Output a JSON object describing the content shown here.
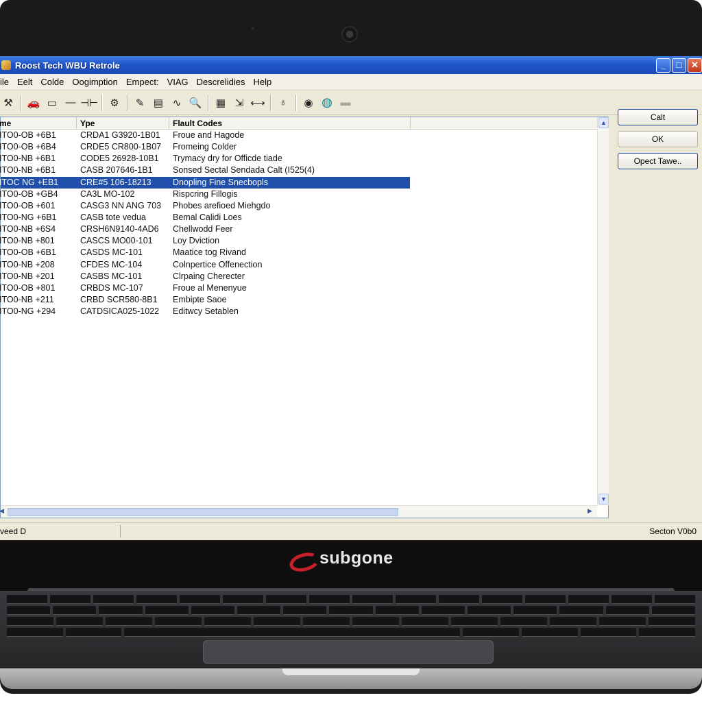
{
  "window": {
    "title": "Roost Tech WBU Retrole",
    "min_glyph": "_",
    "max_glyph": "□",
    "close_glyph": "✕"
  },
  "menu": [
    "ile",
    "Eelt",
    "Colde",
    "Oogimption",
    "Empect:",
    "VIAG",
    "Descrelidies",
    "Help"
  ],
  "toolbar": {
    "icons": [
      "wrench-icon",
      "car-icon",
      "monitor-icon",
      "minus-icon",
      "split-icon",
      "gauge-icon",
      "edit-icon",
      "clipboard-icon",
      "chart-icon",
      "search-icon",
      "list-icon",
      "export-icon",
      "arrows-icon",
      "bulb-icon",
      "globe-icon",
      "help-circle-icon",
      "printer-icon"
    ],
    "glyphs": [
      "⚒",
      "🚗",
      "▭",
      "—",
      "⊣⊢",
      "⚙",
      "✎",
      "▤",
      "∿",
      "🔍",
      "▦",
      "⇲",
      "⟷",
      "♁",
      "◉",
      "◍",
      "▬"
    ]
  },
  "list": {
    "columns": [
      "me",
      "Ype",
      "Flault Codes"
    ],
    "rows": [
      {
        "name": "ITO0-OB +6B1",
        "type": "CRDA1 G3920-1B01",
        "code": "Froue and Hagode"
      },
      {
        "name": "ITO0-OB +6B4",
        "type": "CRDE5 CR800-1B07",
        "code": "Fromeing Colder"
      },
      {
        "name": "ITO0-NB +6B1",
        "type": "CODE5 26928-10B1",
        "code": "Trymacy dry for Officde tiade"
      },
      {
        "name": "ITO0-NB +6B1",
        "type": "CASB 207646-1B1",
        "code": "Sonsed Sectal Sendada Calt (I525(4)"
      },
      {
        "name": "ITOC NG +EB1",
        "type": "CRE#5 106-18213",
        "code": "Dnopling Fine Snecbopls"
      },
      {
        "name": "ITO0-OB +GB4",
        "type": "CA3L MO-102",
        "code": "Rispcring Fillogis"
      },
      {
        "name": "ITO0-OB +601",
        "type": "CASG3 NN ANG 703",
        "code": "Phobes arefioed Miehgdo"
      },
      {
        "name": "ITO0-NG +6B1",
        "type": "CASB tote vedua",
        "code": "Bemal Calidi Loes"
      },
      {
        "name": "ITO0-NB +6S4",
        "type": "CRSH6N9140-4AD6",
        "code": "Chellwodd Feer"
      },
      {
        "name": "ITO0-NB +801",
        "type": "CASCS MO00-101",
        "code": "Loy Dviction"
      },
      {
        "name": "ITO0-OB +6B1",
        "type": "CASDS MC-101",
        "code": "Maatice tog Rivand"
      },
      {
        "name": "ITO0-NB +208",
        "type": "CFDES MC-104",
        "code": "Colnpertice Offenection"
      },
      {
        "name": "ITO0-NB +201",
        "type": "CASBS MC-101",
        "code": "Clrpaing Cherecter"
      },
      {
        "name": "ITO0-OB +801",
        "type": "CRBDS MC-107",
        "code": "Froue al Menenyue"
      },
      {
        "name": "ITO0-NB +211",
        "type": "CRBD SCR580-8B1",
        "code": "Embipte Saoe"
      },
      {
        "name": "ITO0-NG +294",
        "type": "CATDSICA025-1022",
        "code": "Editwcy Setablen"
      }
    ],
    "selected_index": 4,
    "scroll_up": "▲",
    "scroll_down": "▼",
    "scroll_left": "◀",
    "scroll_right": "▶"
  },
  "buttons": {
    "calt": "Calt",
    "ok": "OK",
    "opect": "Opect Tawe.."
  },
  "status": {
    "left": "veed D",
    "right": "Secton V0b0"
  },
  "brand": {
    "name": "subgone",
    "logo_color": "#c8202a"
  },
  "colors": {
    "titlebar": "#1f55c9",
    "selection": "#1f4fa8",
    "window_bg": "#ece9d8"
  }
}
